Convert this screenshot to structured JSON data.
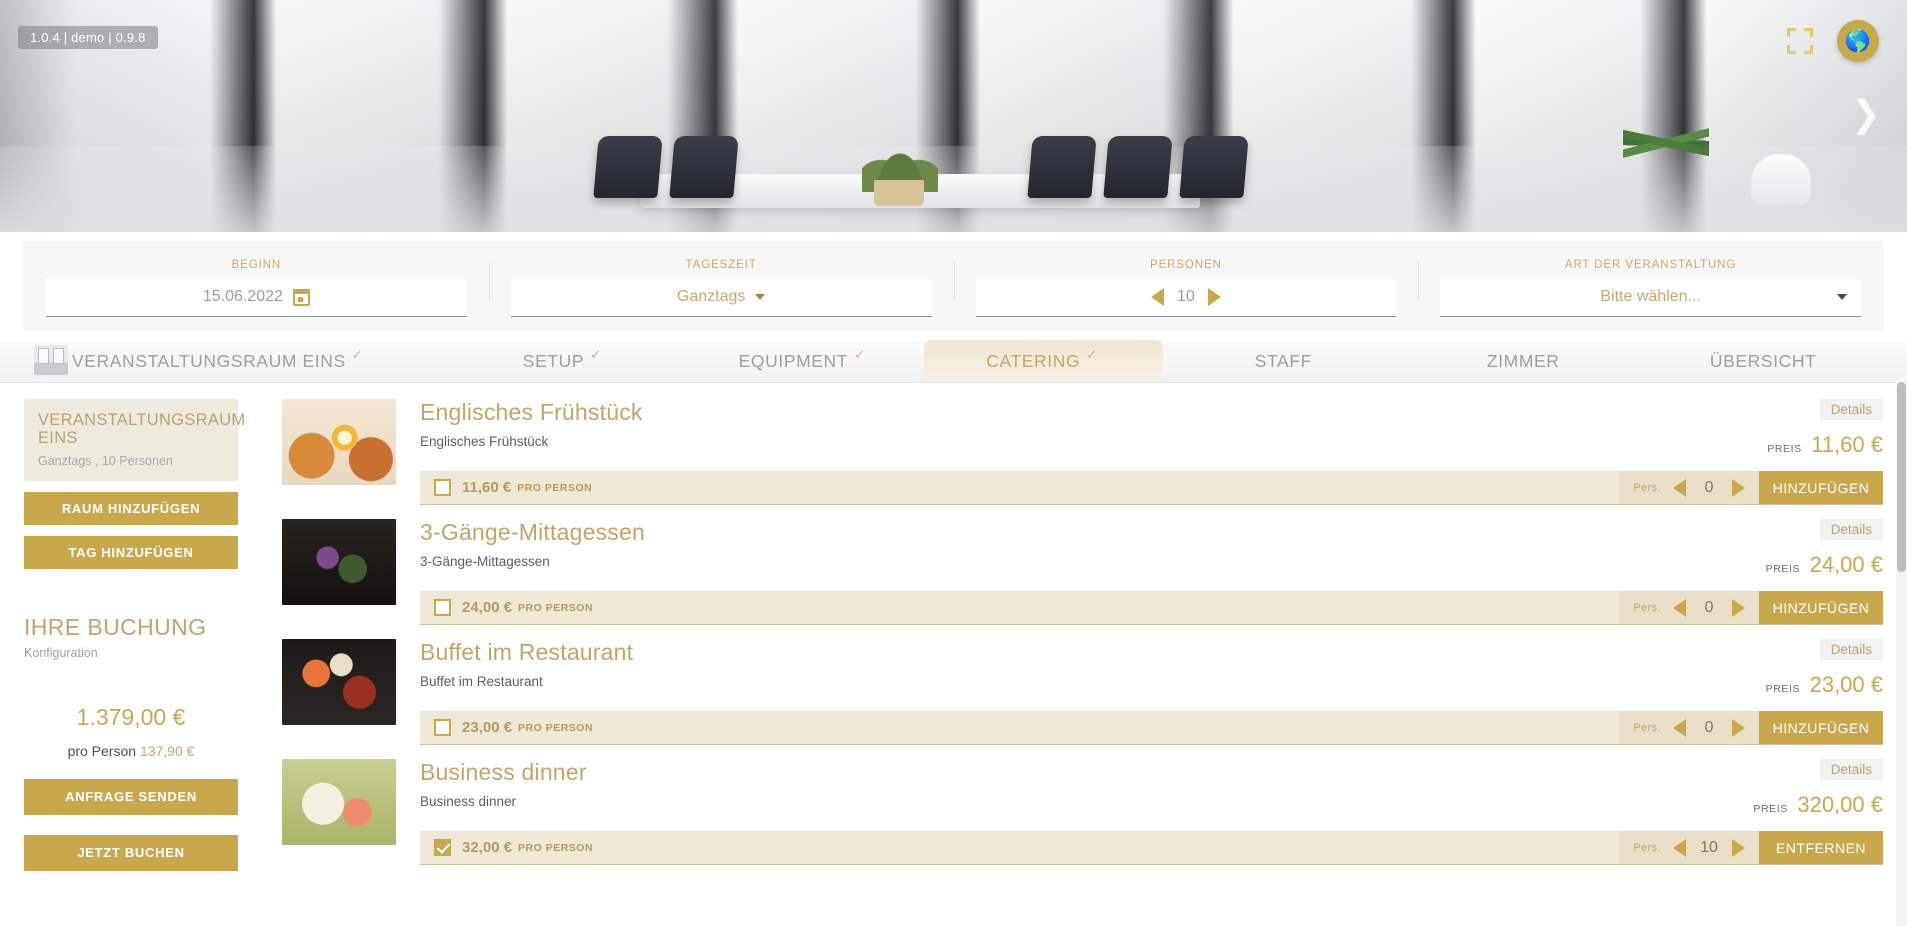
{
  "hero": {
    "version_badge": "1.0.4 | demo | 0.9.8",
    "fullscreen_icon": "fullscreen-icon",
    "globe_icon": "globe-icon",
    "next_arrow": "❯"
  },
  "searchbar": {
    "fields": [
      {
        "label": "BEGINN",
        "value": "15.06.2022",
        "icon": "calendar-icon",
        "type": "date"
      },
      {
        "label": "TAGESZEIT",
        "value": "Ganztags",
        "type": "select"
      },
      {
        "label": "PERSONEN",
        "value": "10",
        "type": "stepper"
      },
      {
        "label": "ART DER VERANSTALTUNG",
        "value": "Bitte wählen...",
        "type": "select-placeholder"
      }
    ]
  },
  "tabs": [
    {
      "label": "VERANSTALTUNGSRAUM EINS",
      "checked": true,
      "active": false
    },
    {
      "label": "SETUP",
      "checked": true,
      "active": false
    },
    {
      "label": "EQUIPMENT",
      "checked": true,
      "active": false
    },
    {
      "label": "CATERING",
      "checked": true,
      "active": true
    },
    {
      "label": "STAFF",
      "checked": false,
      "active": false
    },
    {
      "label": "ZIMMER",
      "checked": false,
      "active": false
    },
    {
      "label": "ÜBERSICHT",
      "checked": false,
      "active": false
    }
  ],
  "sidebar": {
    "room_card": {
      "title": "VERANSTALTUNGSRAUM EINS",
      "subtitle": "Ganztags , 10 Personen"
    },
    "add_room_label": "RAUM HINZUFÜGEN",
    "add_day_label": "TAG HINZUFÜGEN",
    "booking_title": "IHRE BUCHUNG",
    "booking_subtitle": "Konfiguration",
    "total_price": "1.379,00 €",
    "per_person_label": "pro Person",
    "per_person_price": "137,90 €",
    "send_request_label": "ANFRAGE SENDEN",
    "book_now_label": "JETZT BUCHEN"
  },
  "labels": {
    "details": "Details",
    "price_prefix": "PREIS",
    "per_person_unit": "PRO PERSON",
    "persons_short": "Pers.",
    "add": "HINZUFÜGEN",
    "remove": "ENTFERNEN"
  },
  "catering_items": [
    {
      "title": "Englisches Frühstück",
      "description": "Englisches Frühstück",
      "price": "11,60 €",
      "unit_price": "11,60 €",
      "quantity": "0",
      "selected": false,
      "action_label": "HINZUFÜGEN",
      "thumb": "english-breakfast-photo"
    },
    {
      "title": "3-Gänge-Mittagessen",
      "description": "3-Gänge-Mittagessen",
      "price": "24,00 €",
      "unit_price": "24,00 €",
      "quantity": "0",
      "selected": false,
      "action_label": "HINZUFÜGEN",
      "thumb": "three-course-lunch-photo"
    },
    {
      "title": "Buffet im Restaurant",
      "description": "Buffet im Restaurant",
      "price": "23,00 €",
      "unit_price": "23,00 €",
      "quantity": "0",
      "selected": false,
      "action_label": "HINZUFÜGEN",
      "thumb": "restaurant-buffet-photo"
    },
    {
      "title": "Business dinner",
      "description": "Business dinner",
      "price": "320,00 €",
      "unit_price": "32,00 €",
      "quantity": "10",
      "selected": true,
      "action_label": "ENTFERNEN",
      "thumb": "business-dinner-photo"
    }
  ],
  "colors": {
    "gold": "#c9a84c",
    "gold_text": "#c2a566",
    "beige_row": "#efe8d7",
    "beige_stepper": "#e8dfc8",
    "tab_active_bg": "#f0e6d3"
  }
}
